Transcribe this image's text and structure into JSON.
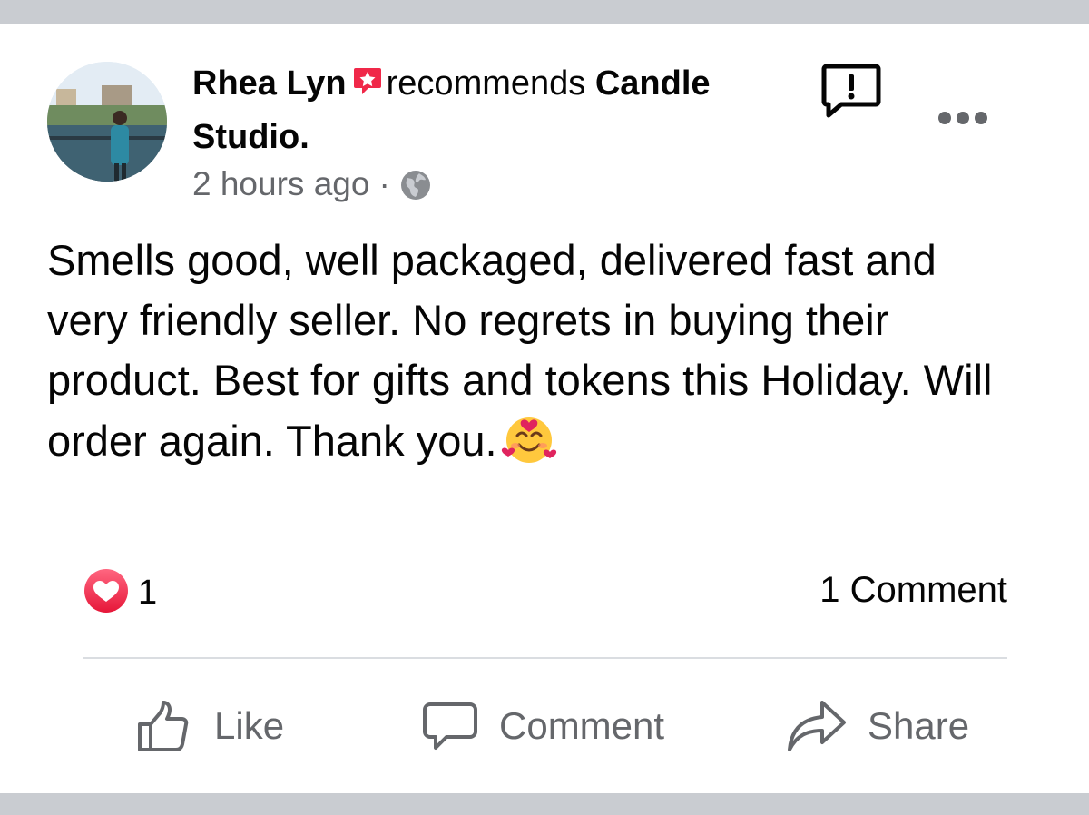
{
  "post": {
    "author": "Rhea Lyn",
    "recommends_word": "recommends",
    "page_name": "Candle Studio.",
    "timestamp": "2 hours ago",
    "separator": "·",
    "privacy_icon": "globe-icon",
    "text": "Smells good, well packaged,  delivered fast and very friendly seller. No regrets in buying their product.  Best for gifts and tokens this Holiday. Will order again. Thank you.",
    "emoji": "smiling-face-with-hearts"
  },
  "stats": {
    "reaction_icon": "love-reaction-icon",
    "reaction_count": "1",
    "comments": "1 Comment"
  },
  "actions": {
    "like": "Like",
    "comment": "Comment",
    "share": "Share"
  },
  "colors": {
    "band": "#c9ccd1",
    "secondary_text": "#65676b",
    "recommend_red": "#f02849",
    "love_red": "#f33e58"
  }
}
